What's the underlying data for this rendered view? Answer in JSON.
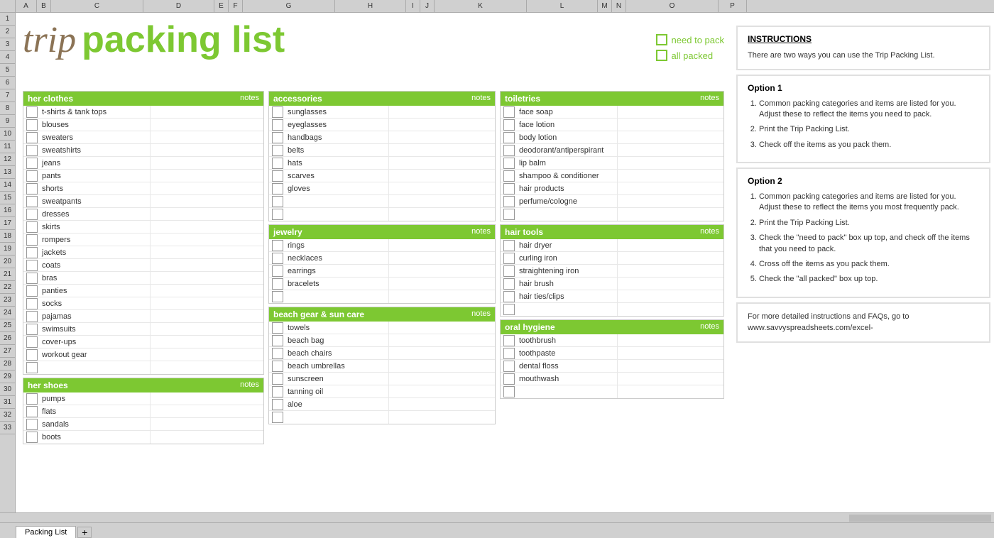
{
  "title": {
    "trip": "trip",
    "packing_list": "packing list"
  },
  "legend": {
    "need_to_pack": "need to pack",
    "all_packed": "all packed"
  },
  "her_clothes": {
    "header": "her clothes",
    "notes_label": "notes",
    "items": [
      "t-shirts & tank tops",
      "blouses",
      "sweaters",
      "sweatshirts",
      "jeans",
      "pants",
      "shorts",
      "sweatpants",
      "dresses",
      "skirts",
      "rompers",
      "jackets",
      "coats",
      "bras",
      "panties",
      "socks",
      "pajamas",
      "swimsuits",
      "cover-ups",
      "workout gear",
      ""
    ]
  },
  "her_shoes": {
    "header": "her shoes",
    "notes_label": "notes",
    "items": [
      "pumps",
      "flats",
      "sandals",
      "boots"
    ]
  },
  "accessories": {
    "header": "accessories",
    "notes_label": "notes",
    "items": [
      "sunglasses",
      "eyeglasses",
      "handbags",
      "belts",
      "hats",
      "scarves",
      "gloves",
      "",
      ""
    ]
  },
  "jewelry": {
    "header": "jewelry",
    "notes_label": "notes",
    "items": [
      "rings",
      "necklaces",
      "earrings",
      "bracelets",
      ""
    ]
  },
  "beach_gear": {
    "header": "beach gear & sun care",
    "notes_label": "notes",
    "items": [
      "towels",
      "beach bag",
      "beach chairs",
      "beach umbrellas",
      "sunscreen",
      "tanning oil",
      "aloe",
      ""
    ]
  },
  "toiletries": {
    "header": "toiletries",
    "notes_label": "notes",
    "items": [
      "face soap",
      "face lotion",
      "body lotion",
      "deodorant/antiperspirant",
      "lip balm",
      "shampoo & conditioner",
      "hair products",
      "perfume/cologne",
      ""
    ]
  },
  "hair_tools": {
    "header": "hair tools",
    "notes_label": "notes",
    "items": [
      "hair dryer",
      "curling iron",
      "straightening iron",
      "hair brush",
      "hair ties/clips",
      ""
    ]
  },
  "oral_hygiene": {
    "header": "oral hygiene",
    "notes_label": "notes",
    "items": [
      "toothbrush",
      "toothpaste",
      "dental floss",
      "mouthwash",
      ""
    ]
  },
  "instructions": {
    "title": "INSTRUCTIONS",
    "intro": "There are two ways you can use the Trip Packing List.",
    "option1": {
      "header": "Option 1",
      "steps": [
        "Common packing categories and items are listed for you.  Adjust these to reflect the items you need to pack.",
        "Print the Trip Packing List.",
        "Check off the items as you pack them."
      ]
    },
    "option2": {
      "header": "Option 2",
      "steps": [
        "Common packing categories and items are listed for you.  Adjust these to reflect the items you most frequently pack.",
        "Print the Trip Packing List.",
        "Check the \"need to pack\" box up top, and check off the items that you need to pack.",
        "Cross off the items as you pack them.",
        "Check the \"all packed\" box up top."
      ]
    },
    "footer": "For more detailed instructions and FAQs, go to www.savvyspreadsheets.com/excel-"
  },
  "tab": {
    "label": "Packing List"
  },
  "col_headers": [
    "A",
    "B",
    "C",
    "D",
    "E",
    "F",
    "G",
    "H",
    "I",
    "J",
    "K",
    "L",
    "M",
    "N",
    "O",
    "P"
  ],
  "row_numbers": [
    "1",
    "2",
    "3",
    "4",
    "5",
    "6",
    "7",
    "8",
    "9",
    "10",
    "11",
    "12",
    "13",
    "14",
    "15",
    "16",
    "17",
    "18",
    "19",
    "20",
    "21",
    "22",
    "23",
    "24",
    "25",
    "26",
    "27",
    "28",
    "29",
    "30",
    "31",
    "32",
    "33"
  ]
}
